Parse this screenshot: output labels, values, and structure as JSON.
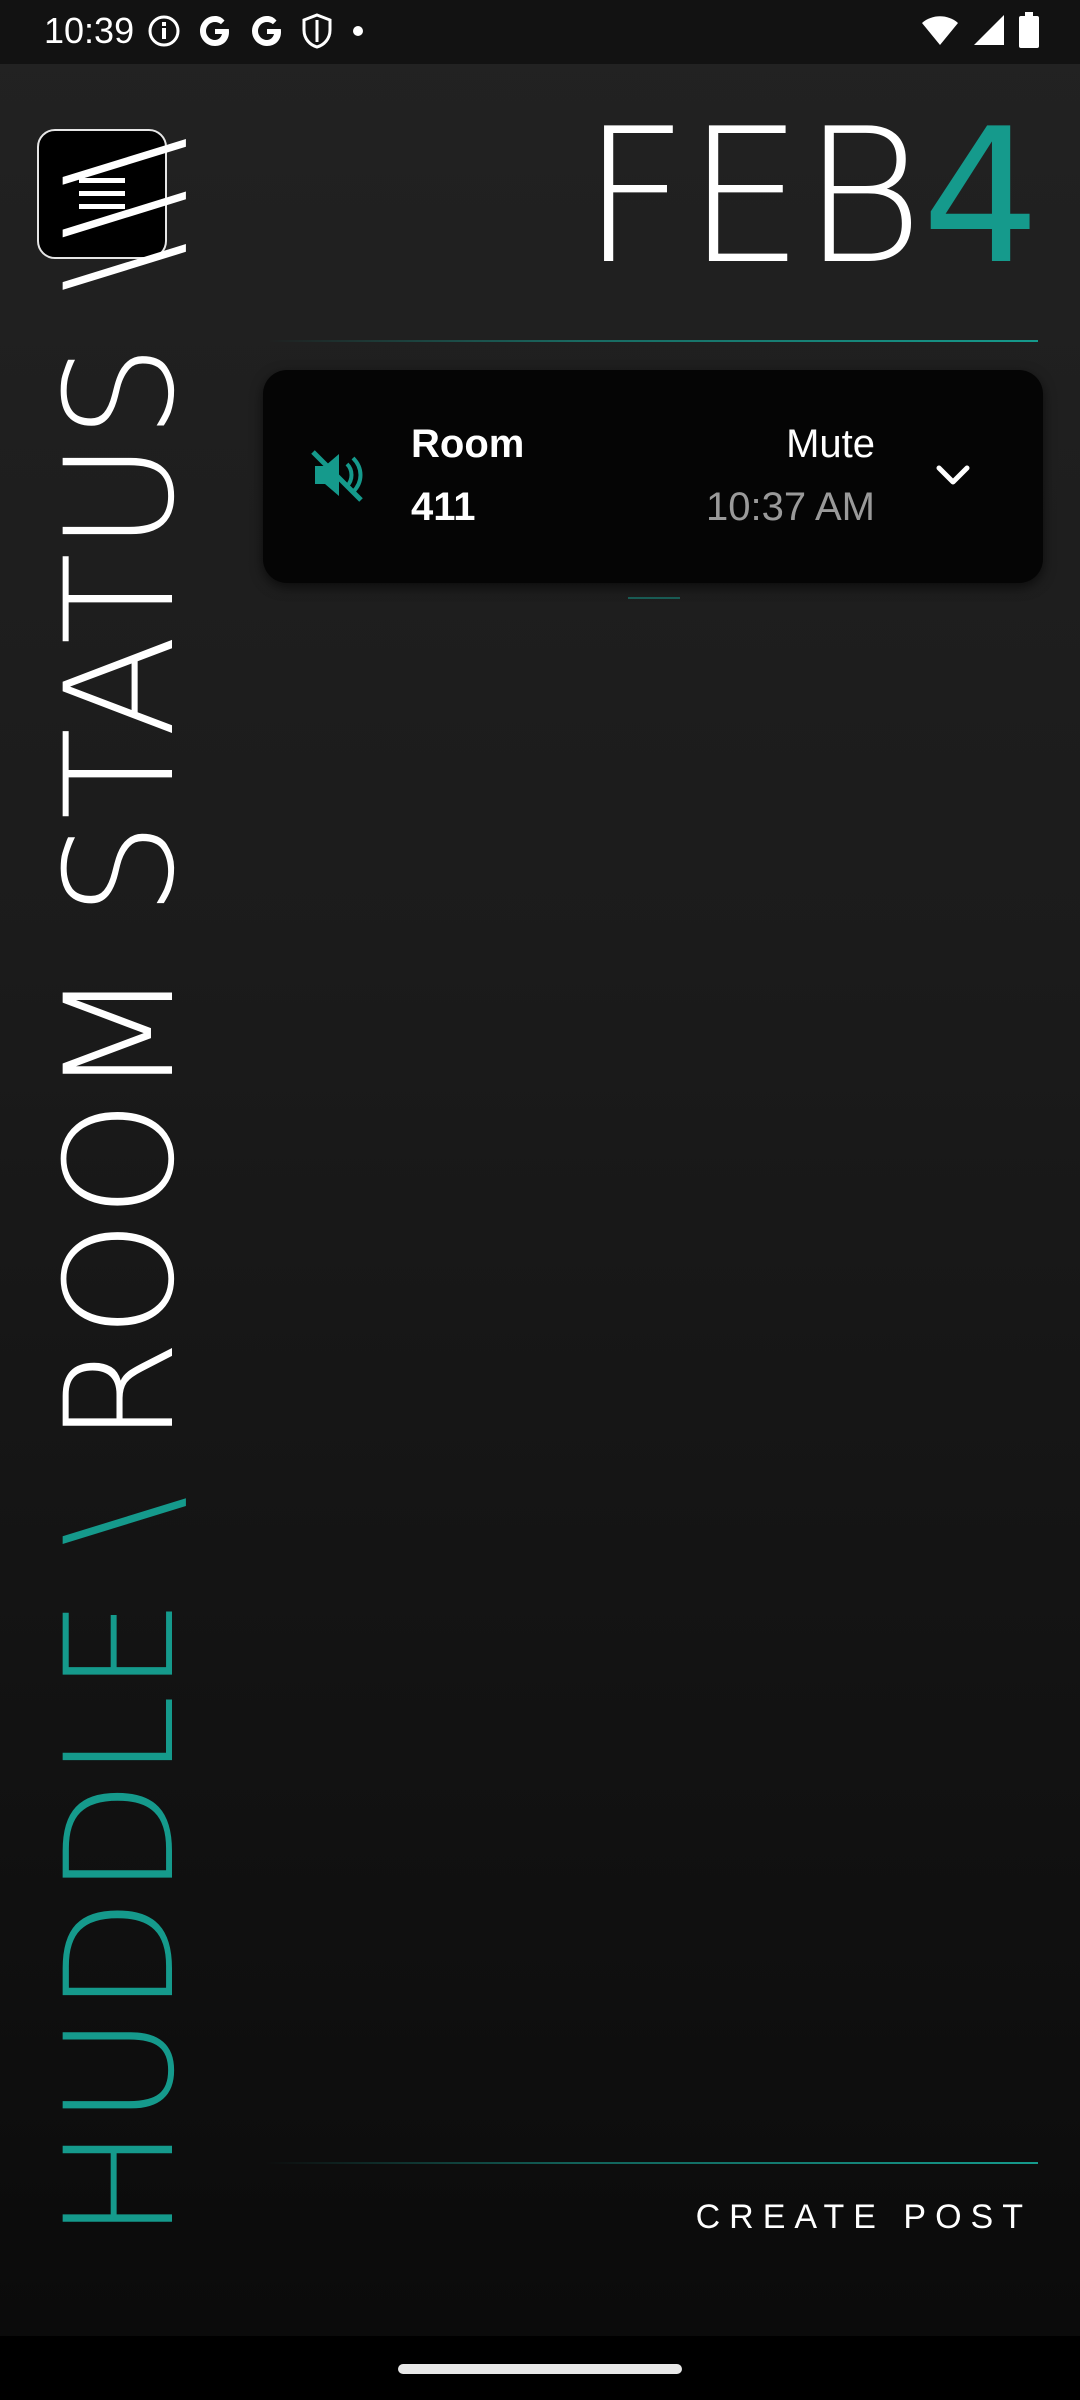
{
  "status_bar": {
    "time": "10:39",
    "left_icons": [
      "info-icon",
      "google-icon",
      "google-icon",
      "shield-icon",
      "dot-icon"
    ],
    "right_icons": [
      "wifi-icon",
      "signal-icon",
      "battery-icon"
    ]
  },
  "header": {
    "menu_icon": "hamburger-menu-icon",
    "date_month": "FEB",
    "date_day": "4"
  },
  "title": {
    "accent": "HUDDLE \\ ",
    "main": "ROOM STATUS \\\\\\"
  },
  "room_card": {
    "status_icon": "volume-off-icon",
    "room_label": "Room",
    "room_number": "411",
    "status": "Mute",
    "time": "10:37 AM",
    "expand_icon": "chevron-down-icon"
  },
  "actions": {
    "create_post": "CREATE POST"
  },
  "colors": {
    "accent": "#159a8c",
    "background": "#1b1b1b",
    "card": "#050505",
    "muted_text": "#9a9a9a"
  }
}
